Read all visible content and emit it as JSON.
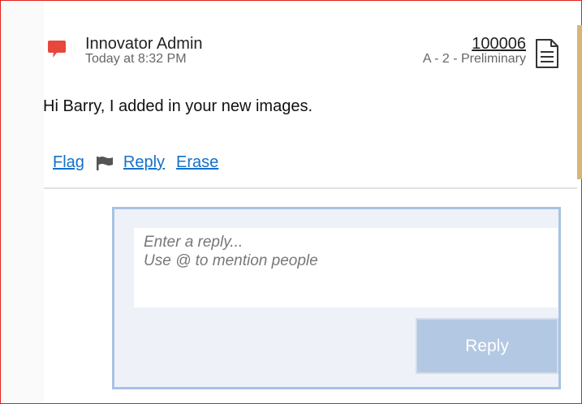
{
  "comment": {
    "author": "Innovator Admin",
    "timestamp": "Today at 8:32 PM",
    "item_number": "100006",
    "item_status": "A - 2 - Preliminary",
    "message": "Hi Barry, I added in your new images.",
    "icons": {
      "comment": "comment-bubble-icon",
      "document": "document-icon",
      "flag": "flag-icon"
    },
    "accent_color": "#e8473c"
  },
  "actions": {
    "flag_label": "Flag",
    "reply_label": "Reply",
    "erase_label": "Erase",
    "link_color": "#1670c9"
  },
  "reply_box": {
    "placeholder": "Enter a reply...\nUse @ to mention people",
    "button_label": "Reply",
    "button_color": "#b3c8e2",
    "border_color": "#a8c2e4"
  }
}
